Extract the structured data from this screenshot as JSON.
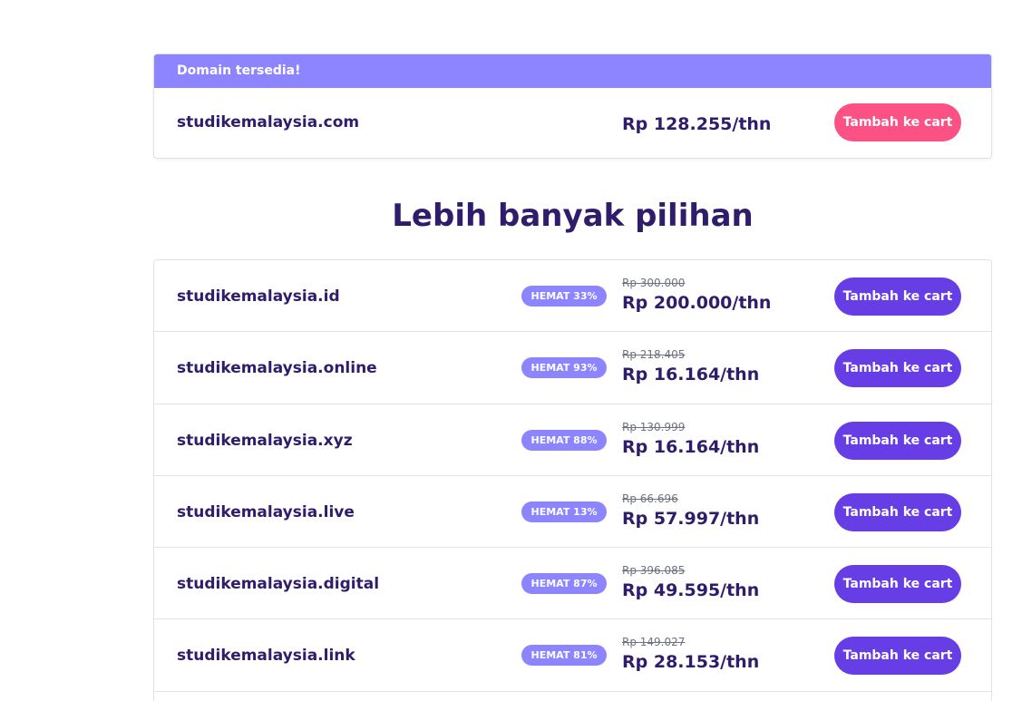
{
  "available": {
    "header": "Domain tersedia!",
    "domain": "studikemalaysia.com",
    "price": "Rp 128.255/thn",
    "button_label": "Tambah ke cart"
  },
  "more": {
    "title": "Lebih banyak pilihan",
    "items": [
      {
        "domain": "studikemalaysia.id",
        "badge": "HEMAT 33%",
        "old_price": "Rp 300.000",
        "price": "Rp 200.000/thn",
        "button_label": "Tambah ke cart"
      },
      {
        "domain": "studikemalaysia.online",
        "badge": "HEMAT 93%",
        "old_price": "Rp 218.405",
        "price": "Rp 16.164/thn",
        "button_label": "Tambah ke cart"
      },
      {
        "domain": "studikemalaysia.xyz",
        "badge": "HEMAT 88%",
        "old_price": "Rp 130.999",
        "price": "Rp 16.164/thn",
        "button_label": "Tambah ke cart"
      },
      {
        "domain": "studikemalaysia.live",
        "badge": "HEMAT 13%",
        "old_price": "Rp 66.696",
        "price": "Rp 57.997/thn",
        "button_label": "Tambah ke cart"
      },
      {
        "domain": "studikemalaysia.digital",
        "badge": "HEMAT 87%",
        "old_price": "Rp 396.085",
        "price": "Rp 49.595/thn",
        "button_label": "Tambah ke cart"
      },
      {
        "domain": "studikemalaysia.link",
        "badge": "HEMAT 81%",
        "old_price": "Rp 149.027",
        "price": "Rp 28.153/thn",
        "button_label": "Tambah ke cart"
      }
    ]
  },
  "colors": {
    "header_bg": "#8c85ff",
    "primary_button": "#673de6",
    "accent_button": "#fc5185",
    "text": "#2f1c6a"
  }
}
